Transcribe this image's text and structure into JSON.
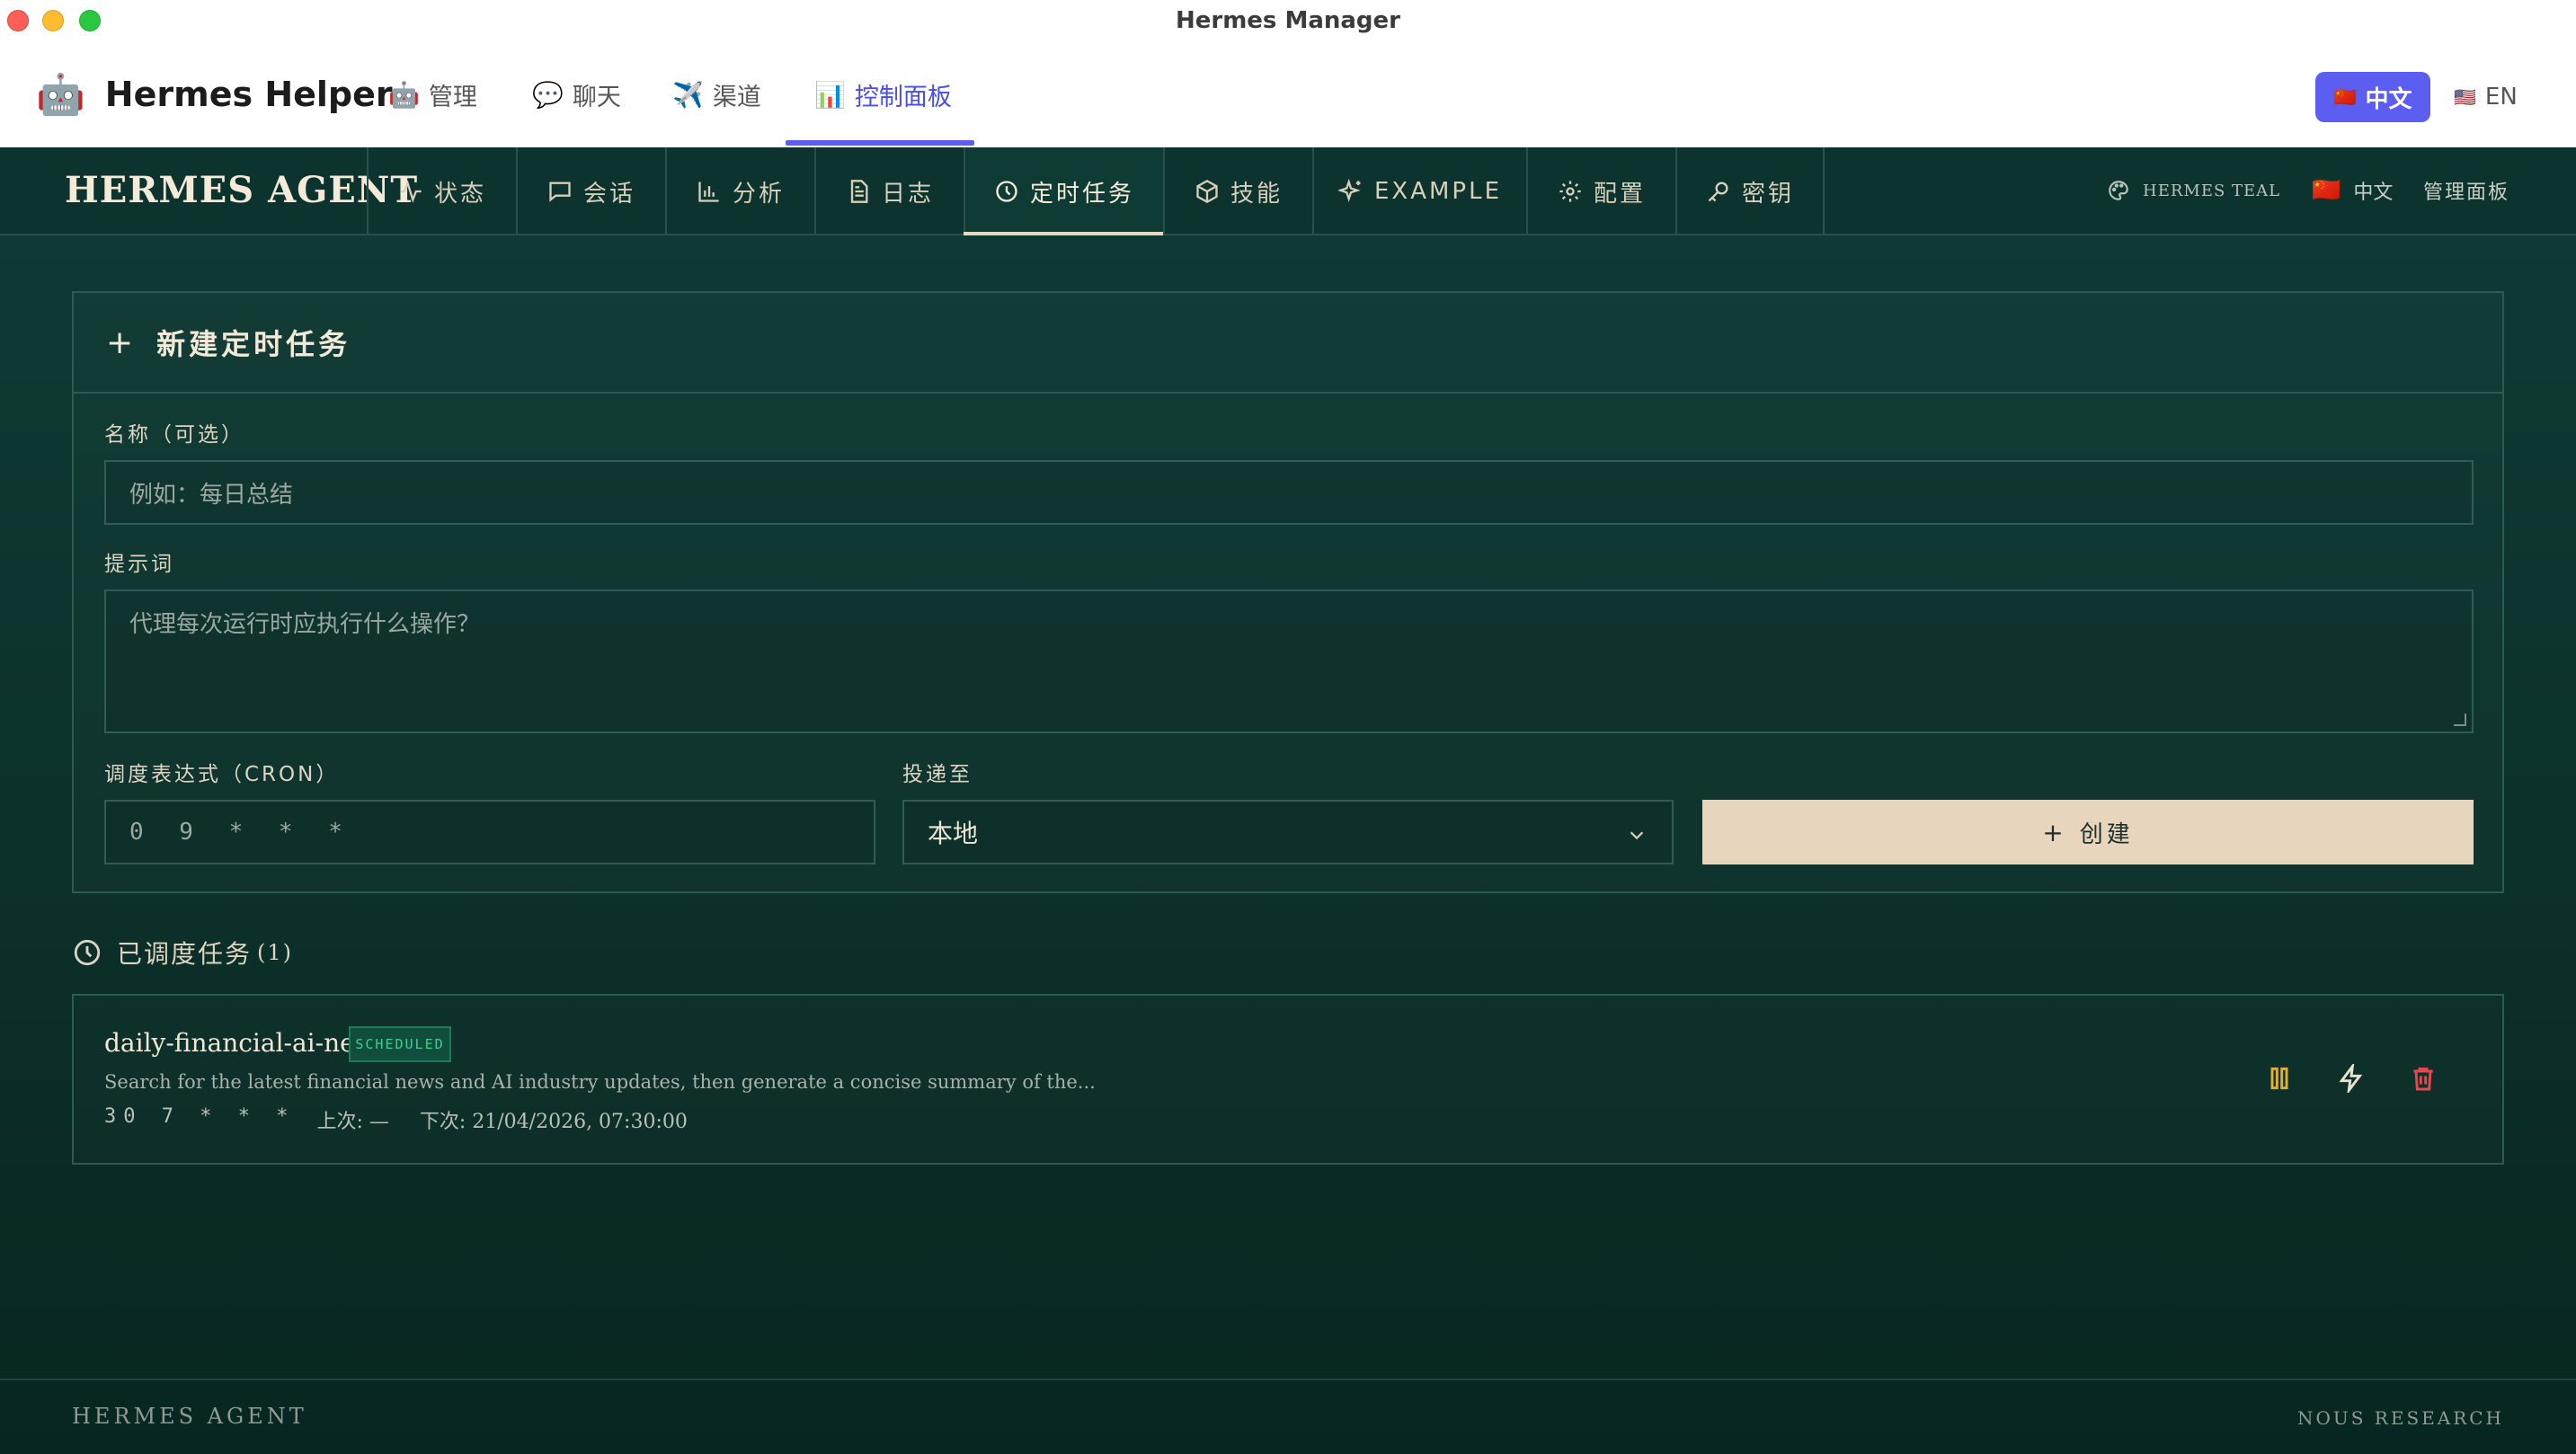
{
  "window": {
    "title": "Hermes Manager"
  },
  "app": {
    "emoji": "🤖",
    "name": "Hermes Helper",
    "tabs": [
      {
        "icon": "🤖",
        "label": "管理"
      },
      {
        "icon": "💬",
        "label": "聊天"
      },
      {
        "icon": "✈️",
        "label": "渠道"
      },
      {
        "icon": "📊",
        "label": "控制面板",
        "active": true
      }
    ],
    "lang_zh": {
      "flag": "🇨🇳",
      "label": "中文"
    },
    "lang_en": {
      "flag": "🇺🇸",
      "label": "EN"
    },
    "accent_color": "#5b5ef0"
  },
  "dashboard": {
    "logo": "HERMES AGENT",
    "nav": [
      {
        "icon": "activity-icon",
        "label": "状态"
      },
      {
        "icon": "chat-icon",
        "label": "会话"
      },
      {
        "icon": "bar-chart-icon",
        "label": "分析"
      },
      {
        "icon": "document-icon",
        "label": "日志"
      },
      {
        "icon": "clock-icon",
        "label": "定时任务",
        "active": true
      },
      {
        "icon": "package-icon",
        "label": "技能"
      },
      {
        "icon": "sparkles-icon",
        "label": "EXAMPLE"
      },
      {
        "icon": "gear-icon",
        "label": "配置"
      },
      {
        "icon": "key-icon",
        "label": "密钥"
      }
    ],
    "theme": "HERMES TEAL",
    "lang": {
      "flag": "🇨🇳",
      "label": "中文"
    },
    "admin": "管理面板",
    "background_color": "#0f3b34"
  },
  "create_form": {
    "title": "新建定时任务",
    "name_label": "名称（可选）",
    "name_placeholder": "例如：每日总结",
    "prompt_label": "提示词",
    "prompt_placeholder": "代理每次运行时应执行什么操作？",
    "cron_label": "调度表达式（CRON）",
    "cron_placeholder": "0 9 * * *",
    "deliver_label": "投递至",
    "deliver_value": "本地",
    "create_label": "创建"
  },
  "scheduled": {
    "title": "已调度任务",
    "count": "(1)",
    "jobs": [
      {
        "name": "daily-financial-ai-news",
        "status": "SCHEDULED",
        "description": "Search for the latest financial news and AI industry updates, then generate a concise summary of the...",
        "cron": "30 7 * * *",
        "last": "上次: —",
        "next": "下次: 21/04/2026, 07:30:00"
      }
    ]
  },
  "footer": {
    "left": "HERMES AGENT",
    "right": "NOUS RESEARCH"
  }
}
